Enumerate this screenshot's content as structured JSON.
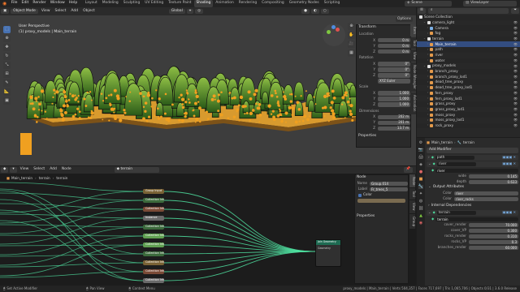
{
  "menu": [
    "File",
    "Edit",
    "Render",
    "Window",
    "Help"
  ],
  "workspaces": [
    "Layout",
    "Modeling",
    "Sculpting",
    "UV Editing",
    "Texture Paint",
    "Shading",
    "Animation",
    "Rendering",
    "Compositing",
    "Geometry Nodes",
    "Scripting"
  ],
  "active_workspace": "Shading",
  "scene": {
    "label": "Scene",
    "viewlayer": "ViewLayer"
  },
  "viewport": {
    "mode": "Object Mode",
    "view_menu": [
      "View",
      "Select",
      "Add",
      "Object"
    ],
    "orientation": "Global",
    "options": "Options",
    "overlay_title": "User Perspective",
    "overlay_path": "(1) proxy_models | Main_terrain"
  },
  "npanel": {
    "tabs": [
      "Item",
      "Tool",
      "View",
      "Node Wrangler",
      "Animation"
    ],
    "transform": "Transform",
    "location": {
      "label": "Location",
      "x": "0 m",
      "y": "0 m",
      "z": "0 m"
    },
    "rotation": {
      "label": "Rotation",
      "x": "0°",
      "y": "0°",
      "z": "0°",
      "mode": "XYZ Euler"
    },
    "scale": {
      "label": "Scale",
      "x": "1.000",
      "y": "1.000",
      "z": "1.000"
    },
    "dimensions": {
      "label": "Dimensions",
      "x": "202 m",
      "y": "201 m",
      "z": "13.7 m"
    },
    "properties": "Properties"
  },
  "outliner": {
    "root": "Scene Collection",
    "items": [
      {
        "label": "camera_light",
        "level": 1,
        "color": "#e0e0e0"
      },
      {
        "label": "Camera",
        "level": 2,
        "color": "#7bb0e6"
      },
      {
        "label": "fog",
        "level": 2,
        "color": "#e39a4c"
      },
      {
        "label": "terrain",
        "level": 1,
        "color": "#e0e0e0"
      },
      {
        "label": "Main_terrain",
        "level": 2,
        "color": "#e39a4c",
        "selected": true
      },
      {
        "label": "path",
        "level": 2,
        "color": "#e39a4c"
      },
      {
        "label": "river",
        "level": 2,
        "color": "#e39a4c"
      },
      {
        "label": "water",
        "level": 2,
        "color": "#e39a4c"
      },
      {
        "label": "proxy_models",
        "level": 1,
        "color": "#e0e0e0"
      },
      {
        "label": "branch_proxy",
        "level": 2,
        "color": "#e39a4c"
      },
      {
        "label": "branch_proxy_lod1",
        "level": 2,
        "color": "#e39a4c"
      },
      {
        "label": "dead_tree_proxy",
        "level": 2,
        "color": "#e39a4c"
      },
      {
        "label": "dead_tree_proxy_lod1",
        "level": 2,
        "color": "#e39a4c"
      },
      {
        "label": "fern_proxy",
        "level": 2,
        "color": "#e39a4c"
      },
      {
        "label": "fern_proxy_lod1",
        "level": 2,
        "color": "#e39a4c"
      },
      {
        "label": "grass_proxy",
        "level": 2,
        "color": "#e39a4c"
      },
      {
        "label": "grass_proxy_lod1",
        "level": 2,
        "color": "#e39a4c"
      },
      {
        "label": "moss_proxy",
        "level": 2,
        "color": "#e39a4c"
      },
      {
        "label": "moss_proxy_lod1",
        "level": 2,
        "color": "#e39a4c"
      },
      {
        "label": "rock_proxy",
        "level": 2,
        "color": "#e39a4c"
      }
    ]
  },
  "properties": {
    "breadcrumb": [
      "Main_terrain",
      "terrain"
    ],
    "add_modifier": "Add Modifier",
    "modifiers": [
      {
        "name": "path"
      },
      {
        "name": "river"
      }
    ],
    "river_panel": {
      "name": "river",
      "wide_label": "wide",
      "wide": "0.145",
      "depth_label": "depth",
      "depth": "0.633"
    },
    "output_attributes": {
      "title": "Output Attributes",
      "rows": [
        {
          "label": "Color",
          "value": "river"
        },
        {
          "label": "Color",
          "value": "river_rocks"
        }
      ]
    },
    "internal_dependencies": "Internal Dependencies",
    "terrain_mod": {
      "name": "terrain",
      "sub": "terrain",
      "rows": [
        {
          "label": "cover_render",
          "value": "70.000"
        },
        {
          "label": "cover_VP",
          "value": "0.300"
        },
        {
          "label": "rocks_render",
          "value": "0.310"
        },
        {
          "label": "rocks_VP",
          "value": "0.3"
        },
        {
          "label": "branches_render",
          "value": "60.000"
        }
      ]
    }
  },
  "node_editor": {
    "menu": [
      "View",
      "Select",
      "Add",
      "Node"
    ],
    "datablock": "terrain",
    "breadcrumb": [
      "Main_terrain",
      "terrain",
      "terrain"
    ],
    "nodes": [
      {
        "label": "Group Input",
        "color": "#7a6235"
      },
      {
        "label": "Collection Info",
        "color": "#3c6a3c"
      },
      {
        "label": "Collection Info",
        "color": "#7a4a36"
      },
      {
        "label": "Instance",
        "color": "#6a6a6a"
      },
      {
        "label": "Collection Info",
        "color": "#3c6a3c"
      },
      {
        "label": "Collection Info",
        "color": "#61a052"
      },
      {
        "label": "Collection Info",
        "color": "#61a052"
      },
      {
        "label": "Collection Info",
        "color": "#3c6a3c"
      },
      {
        "label": "Collection Info",
        "color": "#7a6235"
      },
      {
        "label": "Collection Info",
        "color": "#7a4a36"
      },
      {
        "label": "Collection Info",
        "color": "#6a6a6a"
      }
    ],
    "join_node": "Join Geometry",
    "join_socket": "Geometry",
    "side_panel": {
      "node_title": "Node",
      "name_label": "Name",
      "name_value": "Group.014",
      "label_label": "Label",
      "label_value": "Fr_trees_5",
      "color_label": "Color",
      "properties": "Properties",
      "tabs": [
        "Node",
        "Tool",
        "View",
        "Group"
      ]
    }
  },
  "statusbar": {
    "left": "Set Active Modifier",
    "mid1": "Pan View",
    "mid2": "Context Menu",
    "stats": "proxy_models | Main_terrain | Verts 504,357 | Faces 717,697 | Tris 1,065,706 | Objects 0/31 | 3.6.0 Release"
  },
  "colors": {
    "accent": "#4772b3",
    "orange": "#e39a4c",
    "green_trees": "#3f7a25",
    "terrain": "#d89a2e",
    "wire": "#4fe0a0"
  }
}
